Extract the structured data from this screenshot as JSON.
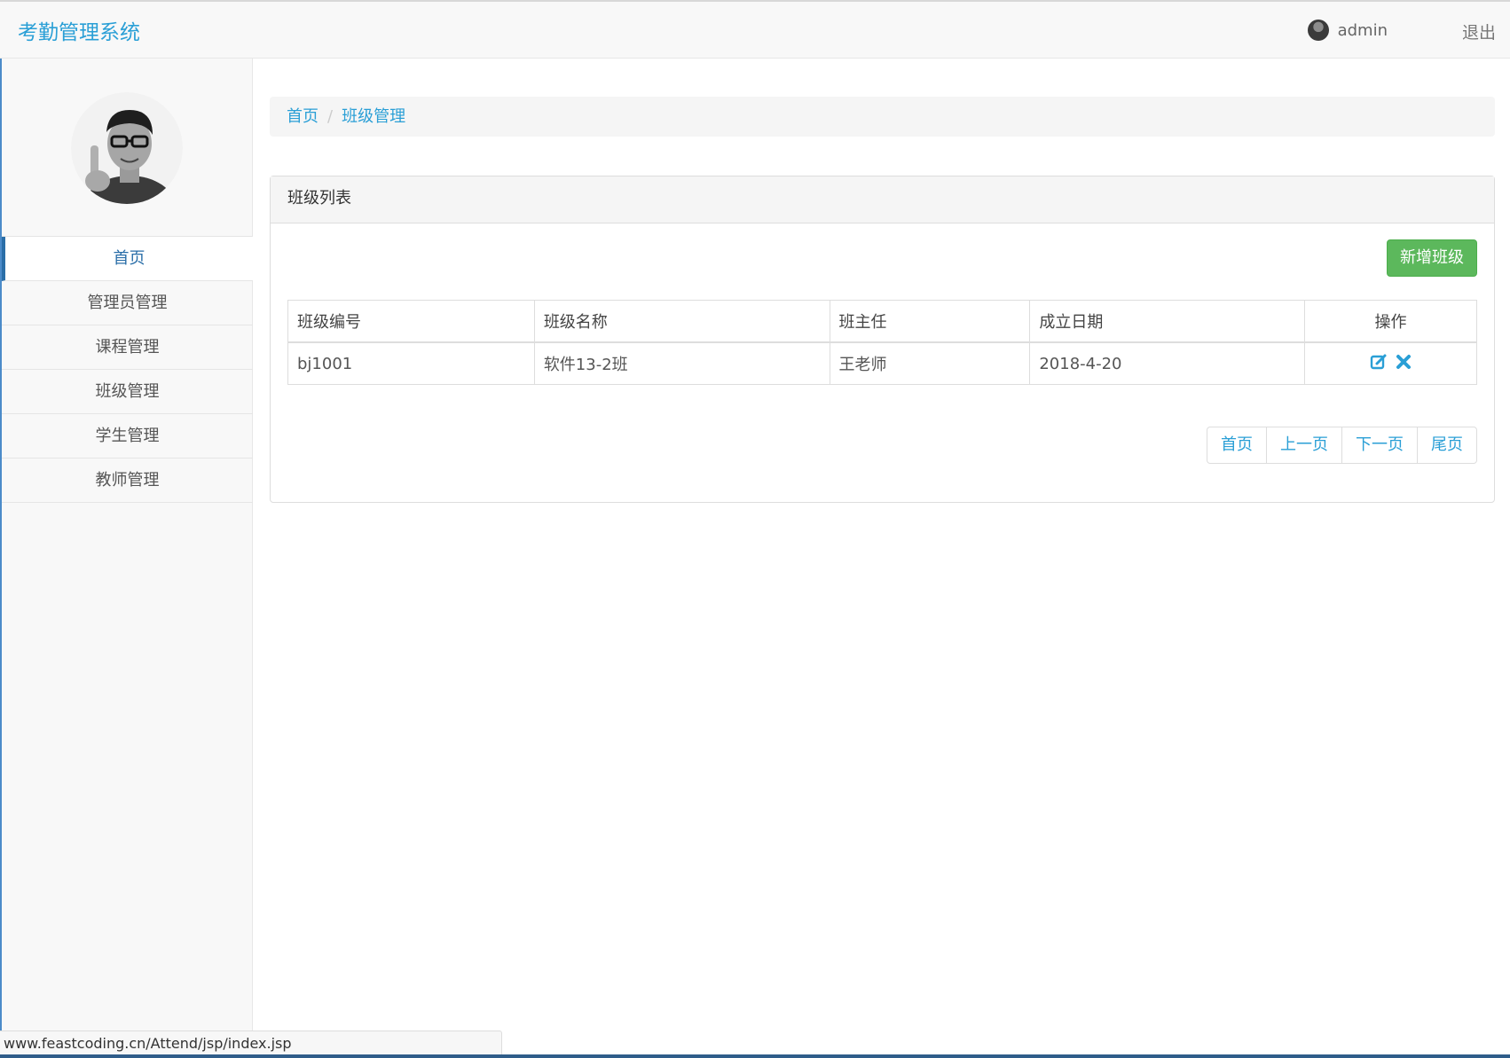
{
  "header": {
    "brand": "考勤管理系统",
    "user": "admin",
    "logout": "退出"
  },
  "sidebar": {
    "items": [
      {
        "label": "首页",
        "active": true
      },
      {
        "label": "管理员管理"
      },
      {
        "label": "课程管理"
      },
      {
        "label": "班级管理"
      },
      {
        "label": "学生管理"
      },
      {
        "label": "教师管理"
      }
    ]
  },
  "breadcrumb": {
    "home": "首页",
    "separator": "/",
    "current": "班级管理"
  },
  "panel": {
    "title": "班级列表",
    "add_button": "新增班级",
    "table": {
      "headers": [
        "班级编号",
        "班级名称",
        "班主任",
        "成立日期",
        "操作"
      ],
      "rows": [
        [
          "bj1001",
          "软件13-2班",
          "王老师",
          "2018-4-20"
        ]
      ]
    },
    "pager": {
      "first": "首页",
      "prev": "上一页",
      "next": "下一页",
      "last": "尾页"
    }
  },
  "statusbar": {
    "url": "www.feastcoding.cn/Attend/jsp/index.jsp"
  },
  "colors": {
    "accent": "#2a9fd6",
    "success": "#5cb85c",
    "nav_active": "#2a6ea8"
  },
  "icons": {
    "edit": "edit-icon",
    "delete": "delete-icon"
  }
}
